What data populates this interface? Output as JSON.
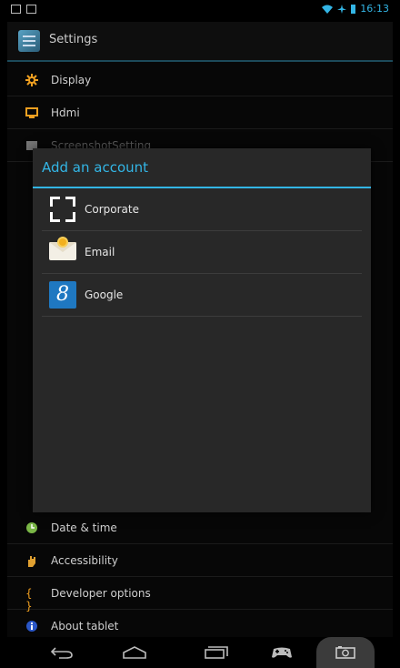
{
  "status_bar": {
    "time": "16:13"
  },
  "action_bar": {
    "title": "Settings"
  },
  "settings_items": [
    {
      "label": "Display",
      "icon": "display-gear-icon"
    },
    {
      "label": "Hdmi",
      "icon": "hdmi-monitor-icon"
    },
    {
      "label": "ScreenshotSetting",
      "icon": "screenshot-icon"
    }
  ],
  "bottom_items": [
    {
      "label": "Date & time",
      "icon": "clock-icon"
    },
    {
      "label": "Accessibility",
      "icon": "hand-icon"
    },
    {
      "label": "Developer options",
      "icon": "braces-icon"
    },
    {
      "label": "About tablet",
      "icon": "info-icon"
    }
  ],
  "dialog": {
    "title": "Add an account",
    "accounts": [
      {
        "label": "Corporate",
        "icon": "corporate-icon"
      },
      {
        "label": "Email",
        "icon": "email-icon"
      },
      {
        "label": "Google",
        "icon": "google-icon",
        "glyph": "8"
      }
    ]
  },
  "nav_bar": {
    "buttons": [
      "back-icon",
      "home-icon",
      "recents-icon",
      "gamepad-icon",
      "screenshot-camera-icon"
    ]
  },
  "colors": {
    "accent": "#33b5e5",
    "dialog_bg": "#282828"
  }
}
